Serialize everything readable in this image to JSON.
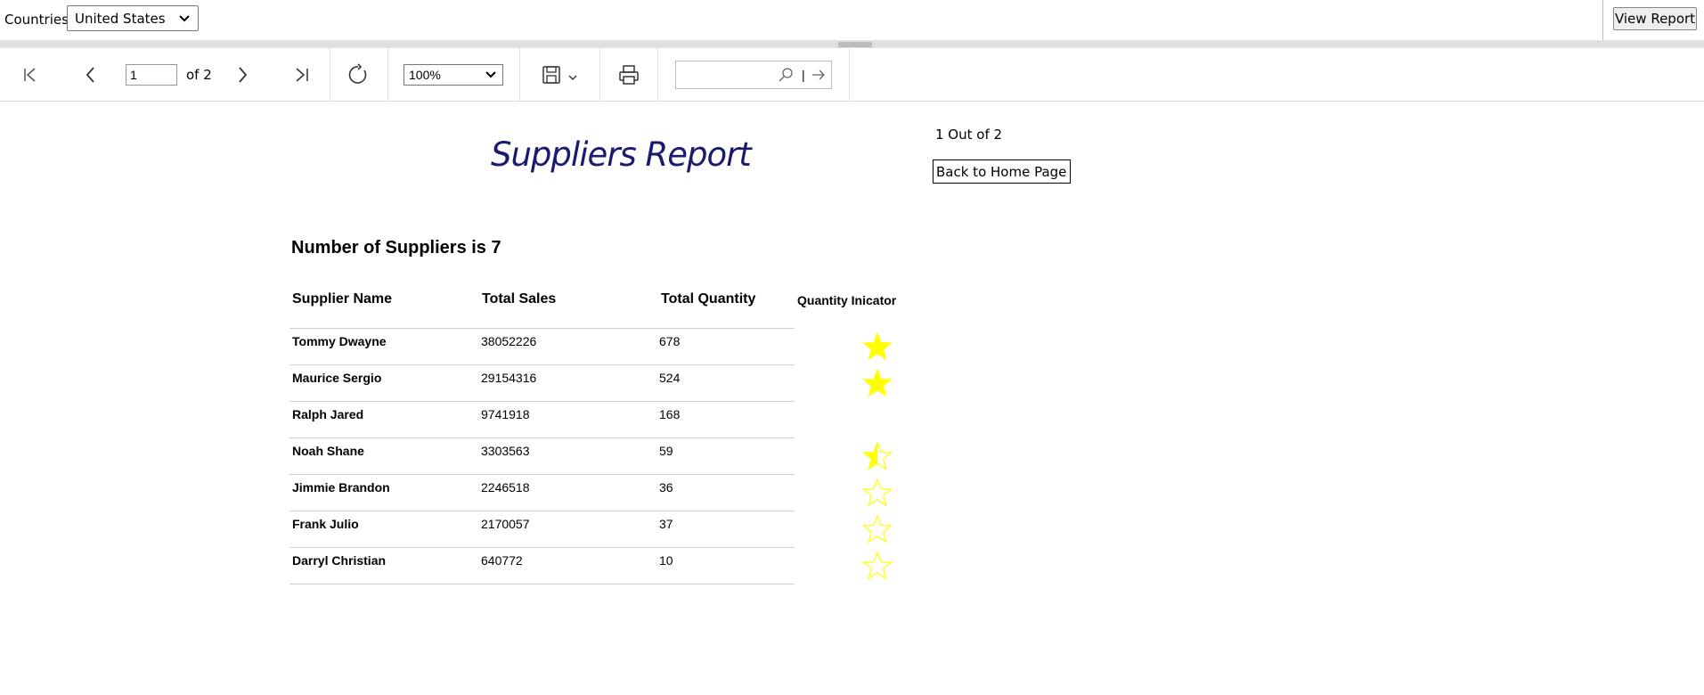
{
  "params": {
    "countries_label": "Countries",
    "country_value": "United States",
    "view_report_label": "View Report"
  },
  "toolbar": {
    "page_value": "1",
    "of_pages": "of 2",
    "zoom_value": "100%"
  },
  "report": {
    "title": "Suppliers Report",
    "page_info": "1 Out of 2",
    "back_home_label": "Back to Home Page",
    "supplier_count": "Number of Suppliers is 7",
    "headers": {
      "name": "Supplier Name",
      "sales": "Total Sales",
      "quantity": "Total Quantity",
      "indicator": "Quantity Inicator"
    },
    "rows": [
      {
        "name": "Tommy Dwayne",
        "sales": "38052226",
        "quantity": "678",
        "indicator": "full"
      },
      {
        "name": "Maurice Sergio",
        "sales": "29154316",
        "quantity": "524",
        "indicator": "full"
      },
      {
        "name": "Ralph Jared",
        "sales": "9741918",
        "quantity": "168",
        "indicator": "none"
      },
      {
        "name": "Noah Shane",
        "sales": "3303563",
        "quantity": "59",
        "indicator": "half"
      },
      {
        "name": "Jimmie Brandon",
        "sales": "2246518",
        "quantity": "36",
        "indicator": "empty"
      },
      {
        "name": "Frank Julio",
        "sales": "2170057",
        "quantity": "37",
        "indicator": "empty"
      },
      {
        "name": "Darryl Christian",
        "sales": "640772",
        "quantity": "10",
        "indicator": "empty"
      }
    ],
    "star_color": "#ffff00"
  }
}
